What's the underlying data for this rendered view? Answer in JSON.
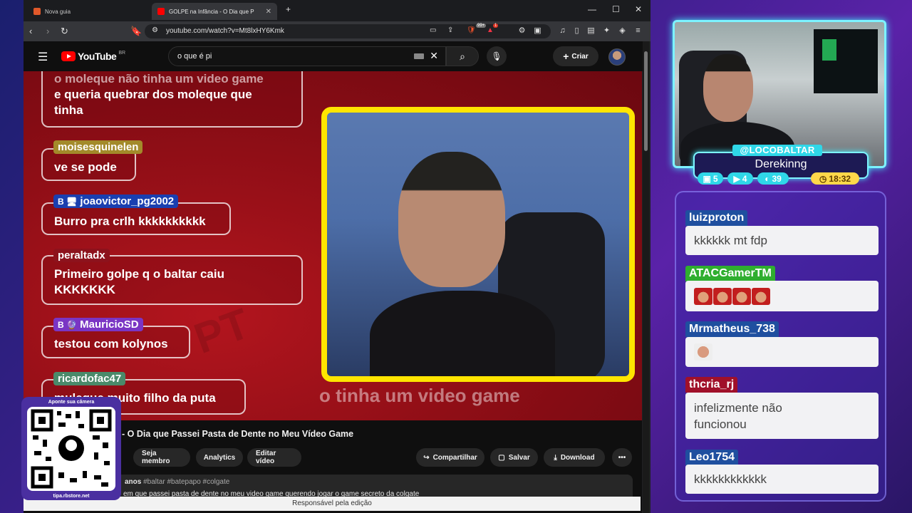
{
  "browser": {
    "tabs": [
      {
        "label": "Nova guia",
        "active": false
      },
      {
        "label": "GOLPE na Infância - O Dia que Pass",
        "active": true
      }
    ],
    "url": "youtube.com/watch?v=Mt8lxHY6Kmk",
    "ext_badges": {
      "shield": "99+",
      "alert": "1"
    }
  },
  "youtube": {
    "logo": "YouTube",
    "country": "BR",
    "search_value": "o que é pi",
    "create_label": "Criar",
    "video_title": "- O Dia que Passei Pasta de Dente no Meu Vídeo Game",
    "buttons": {
      "member": "Seja membro",
      "analytics": "Analytics",
      "edit": "Editar vídeo",
      "share": "Compartilhar",
      "save": "Salvar",
      "download": "Download",
      "more": "•••"
    },
    "desc_age": "anos",
    "desc_tags": "#baltar #batepapo #colgate",
    "desc_line": "em que passei pasta de dente no meu video game querendo jogar o game secreto da colgate",
    "edit_banner": "Responsável pela edição"
  },
  "video_chat": [
    {
      "user": "",
      "text_lines": [
        "o moleque não tinha um video game",
        "e queria quebrar dos moleque que",
        "tinha"
      ]
    },
    {
      "user": "moisesquinelen",
      "text_lines": [
        "ve se pode"
      ],
      "color": "#a38a2a"
    },
    {
      "user": "joaovictor_pg2002",
      "text_lines": [
        "Burro pra crlh kkkkkkkkkk"
      ],
      "color": "#1a3fb0",
      "badges": "B 🖥"
    },
    {
      "user": "peraltadx",
      "text_lines": [
        "Primeiro golpe q o baltar caiu",
        "KKKKKKK"
      ],
      "color": "transparent"
    },
    {
      "user": "MauricioSD",
      "text_lines": [
        "testou com kolynos"
      ],
      "color": "#7a35c4",
      "badges": "B 🔮"
    },
    {
      "user": "ricardofac47",
      "text_lines": [
        "mulegue muito filho da puta"
      ],
      "color": "#4a8a6a"
    }
  ],
  "subtitle": "o tinha um video game",
  "qr": {
    "top": "Aponte sua câmera",
    "bottom": "tipa.rbstore.net"
  },
  "webcam": {
    "handle": "@LOCOBALTAR",
    "name": "Derekinng",
    "stats": [
      {
        "icon": "twitch-icon",
        "value": "5",
        "color": "#2fd7e8"
      },
      {
        "icon": "youtube-icon",
        "value": "4",
        "color": "#2fd7e8"
      },
      {
        "icon": "kick-icon",
        "value": "39",
        "color": "#2fd7e8"
      },
      {
        "icon": "clock-icon",
        "value": "18:32",
        "color": "#ffd84a"
      }
    ]
  },
  "side_chat": [
    {
      "user": "luizproton",
      "text": "kkkkkk mt fdp",
      "color": "#1f4f9f"
    },
    {
      "user": "ATACGamerTM",
      "text": "",
      "emotes": 4,
      "color": "#2fae2f"
    },
    {
      "user": "Mrmatheus_738",
      "text": "",
      "emotes": 1,
      "color": "#1f4f9f"
    },
    {
      "user": "thcria_rj",
      "text": "infelizmente não funcionou",
      "color": "#a0102a"
    },
    {
      "user": "Leo1754",
      "text": "kkkkkkkkkkkk",
      "color": "#1f4f9f"
    }
  ]
}
